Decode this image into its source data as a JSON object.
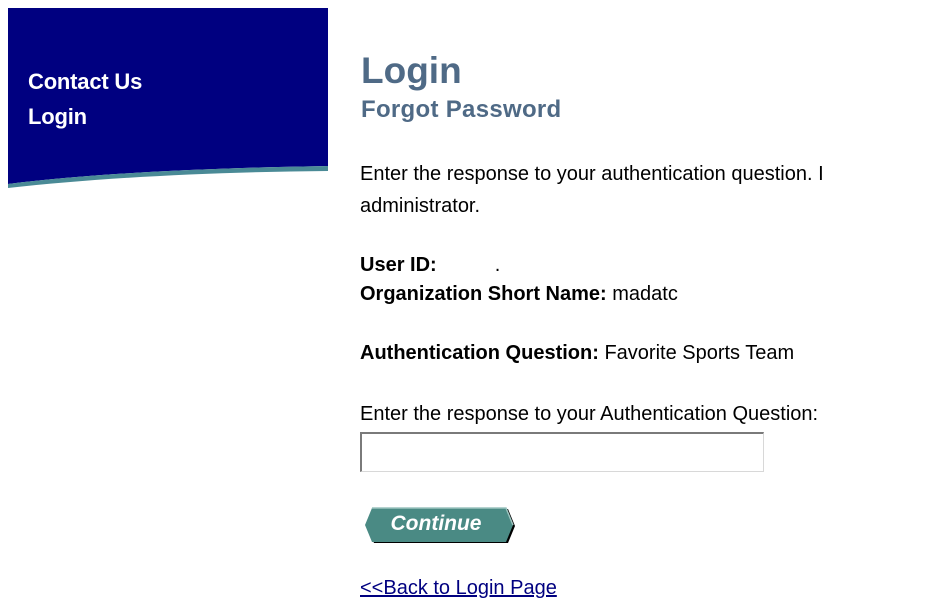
{
  "sidebar": {
    "items": [
      {
        "label": "Contact Us"
      },
      {
        "label": "Login"
      }
    ]
  },
  "main": {
    "title": "Login",
    "subtitle": "Forgot Password",
    "instructions": {
      "line1": "Enter the response to your authentication question. I",
      "line2": "administrator."
    },
    "user_id": {
      "label": "User ID:",
      "value": "."
    },
    "org_short_name": {
      "label": "Organization Short Name:",
      "value": "madatc"
    },
    "auth_question": {
      "label": "Authentication Question:",
      "value": "Favorite Sports Team"
    },
    "response_prompt": "Enter the response to your Authentication Question:",
    "response_input": {
      "value": "",
      "placeholder": ""
    },
    "continue_label": "Continue",
    "back_link": "<<Back to Login Page"
  },
  "colors": {
    "sidebar_bg": "#000080",
    "sidebar_wave": "#4a8a96",
    "heading": "#4f6a86",
    "button": "#4a8a84",
    "link": "#000080"
  }
}
